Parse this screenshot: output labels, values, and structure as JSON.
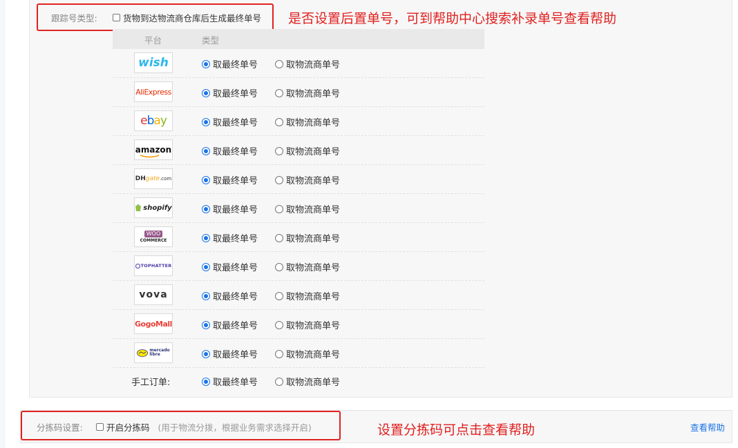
{
  "tracking": {
    "label": "跟踪号类型:",
    "checkbox_label": "货物到达物流商仓库后生成最终单号",
    "annotation": "是否设置后置单号，可到帮助中心搜索补录单号查看帮助"
  },
  "table": {
    "headers": {
      "platform": "平台",
      "type": "类型"
    },
    "option_final": "取最终单号",
    "option_logistics": "取物流商单号",
    "rows": [
      {
        "platform": "wish",
        "selected": "final"
      },
      {
        "platform": "AliExpress",
        "selected": "final"
      },
      {
        "platform": "ebay",
        "selected": "final"
      },
      {
        "platform": "amazon",
        "selected": "final"
      },
      {
        "platform": "DHgate",
        "selected": "final"
      },
      {
        "platform": "shopify",
        "selected": "final"
      },
      {
        "platform": "WooCommerce",
        "selected": "final"
      },
      {
        "platform": "TOPHATTER",
        "selected": "final"
      },
      {
        "platform": "vova",
        "selected": "final"
      },
      {
        "platform": "GogoMall",
        "selected": "final"
      },
      {
        "platform": "mercado libre",
        "selected": "final"
      }
    ],
    "manual": {
      "label": "手工订单:",
      "selected": "final"
    }
  },
  "logos": {
    "wish": "wish",
    "aliexpress_a": "Ali",
    "aliexpress_b": "Express",
    "ebay_e": "e",
    "ebay_b": "b",
    "ebay_a": "a",
    "ebay_y": "y",
    "amazon": "amazon",
    "dhgate_a": "DH",
    "dhgate_b": "gate",
    "dhgate_c": ".com",
    "shopify": "shopify",
    "woo_a": "WOO",
    "woo_b": "COMMERCE",
    "tophatter": "TOPHATTER",
    "vova": "vova",
    "gogo_a": "Gogo",
    "gogo_b": "Mall",
    "mercado_a": "mercado",
    "mercado_b": "libre"
  },
  "sorting": {
    "label": "分拣码设置:",
    "checkbox_label": "开启分拣码",
    "hint": "(用于物流分拨，根据业务需求选择开启)",
    "help_link": "查看帮助",
    "annotation": "设置分拣码可点击查看帮助"
  },
  "colors": {
    "annotation_red": "#e02020",
    "link_blue": "#1a73e8",
    "wish": "#2fb7ec",
    "aliexpress": "#e62e04",
    "ebay_red": "#e53238",
    "ebay_blue": "#0064d2",
    "ebay_yellow": "#f5af02",
    "ebay_green": "#86b817",
    "shopify": "#95bf47",
    "woocommerce": "#96588a",
    "gogomall": "#e8423a",
    "mercado": "#2d3277"
  }
}
